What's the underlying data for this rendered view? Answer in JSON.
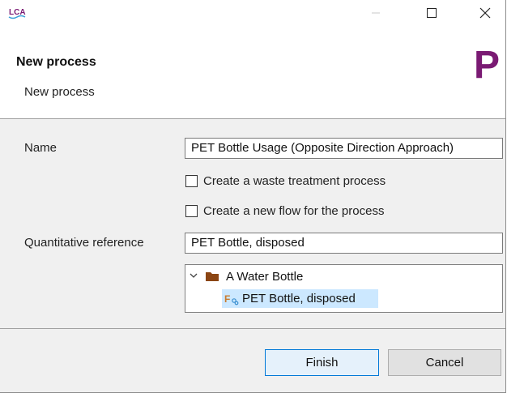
{
  "window": {
    "app_icon": "lca-logo-icon",
    "app_icon_text": "LCA",
    "controls": [
      "minimize-icon",
      "maximize-icon",
      "close-icon"
    ]
  },
  "header": {
    "title": "New process",
    "subtitle": "New process",
    "logo_letter": "P",
    "logo_color": "#7a1a73"
  },
  "form": {
    "name_label": "Name",
    "name_value": "PET Bottle Usage (Opposite Direction Approach)",
    "waste_checkbox_label": "Create a waste treatment process",
    "waste_checked": false,
    "flow_checkbox_label": "Create a new flow for the process",
    "flow_checked": false,
    "quant_ref_label": "Quantitative reference",
    "quant_ref_value": "PET Bottle, disposed"
  },
  "tree": {
    "folder": {
      "label": "A Water Bottle",
      "expanded": true,
      "icon": "folder-icon"
    },
    "child": {
      "label": "PET Bottle, disposed",
      "selected": true,
      "icon": "flow-icon"
    }
  },
  "buttons": {
    "finish": "Finish",
    "cancel": "Cancel"
  },
  "colors": {
    "accent": "#0078d7",
    "selection": "#cce8ff",
    "folder": "#8b4513"
  }
}
